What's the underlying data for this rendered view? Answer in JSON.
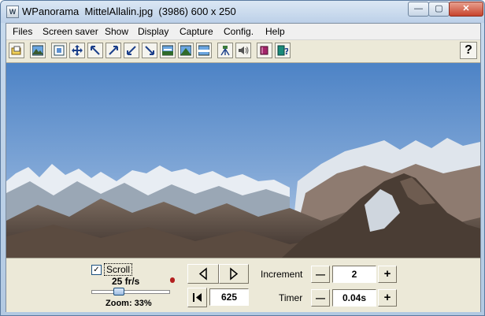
{
  "window": {
    "app_name": "WPanorama",
    "file_name": "MittelAllalin.jpg",
    "dimensions": "(3986) 600 x 250",
    "minimize_glyph": "—",
    "maximize_glyph": "▢",
    "close_glyph": "✕"
  },
  "menu": [
    "Files",
    "Screen saver",
    "Show",
    "Display",
    "Capture",
    "Config.",
    "Help"
  ],
  "toolbar": {
    "icons": [
      "open-file-icon",
      "picture-icon",
      "fit-window-icon",
      "move-icon",
      "shrink-topleft-icon",
      "expand-topright-icon",
      "shrink-bottomleft-icon",
      "expand-bottomright-icon",
      "panorama-view-1-icon",
      "panorama-view-2-icon",
      "panorama-view-3-icon",
      "tripod-icon",
      "speaker-icon",
      "book-icon",
      "help-book-icon"
    ],
    "help_label": "?"
  },
  "controls": {
    "scroll_label": "Scroll",
    "scroll_checked": "✓",
    "fps": "25 fr/s",
    "zoom": "Zoom: 33%",
    "zoom_percent": 33,
    "position": "625",
    "increment_label": "Increment",
    "increment_value": "2",
    "timer_label": "Timer",
    "timer_value": "0.04s",
    "minus": "—",
    "plus": "+"
  }
}
